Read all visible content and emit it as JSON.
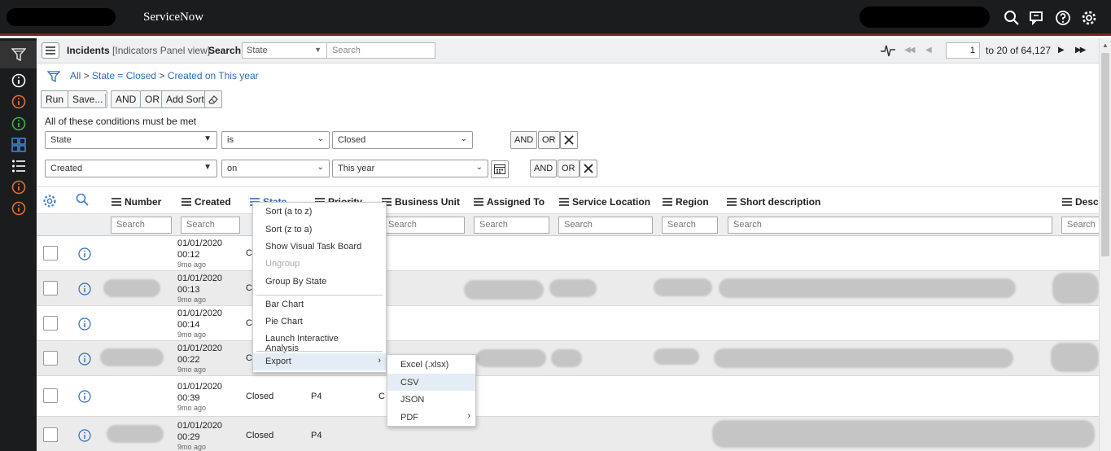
{
  "banner": {
    "brand": "ServiceNow"
  },
  "list_header": {
    "title": "Incidents",
    "view": "[Indicators Panel view]",
    "search_label": "Search",
    "field_select": "State",
    "search_placeholder": "Search",
    "page_value": "1",
    "range_text": "to 20 of 64,127"
  },
  "breadcrumb": {
    "all": "All",
    "sep": ">",
    "state": "State = Closed",
    "created": "Created on This year"
  },
  "filter": {
    "run": "Run",
    "save": "Save...",
    "and": "AND",
    "or": "OR",
    "add_sort": "Add Sort",
    "conditions_title": "All of these conditions must be met",
    "row1": {
      "field": "State",
      "operator": "is",
      "value": "Closed"
    },
    "row2": {
      "field": "Created",
      "operator": "on",
      "value": "This year"
    }
  },
  "columns": {
    "number": "Number",
    "created": "Created",
    "state": "State",
    "priority": "Priority",
    "business_unit": "Business Unit",
    "assigned_to": "Assigned To",
    "service_location": "Service Location",
    "region": "Region",
    "short_description": "Short description",
    "description": "Descri"
  },
  "column_search_placeholder": "Search",
  "rows": [
    {
      "date": "01/01/2020",
      "time": "00:12",
      "ago": "9mo ago",
      "state": "C",
      "priority": "",
      "bu": ""
    },
    {
      "date": "01/01/2020",
      "time": "00:13",
      "ago": "9mo ago",
      "state": "C",
      "priority": "",
      "bu": ""
    },
    {
      "date": "01/01/2020",
      "time": "00:14",
      "ago": "9mo ago",
      "state": "C",
      "priority": "",
      "bu": ""
    },
    {
      "date": "01/01/2020",
      "time": "00:22",
      "ago": "9mo ago",
      "state": "C",
      "priority": "",
      "bu": ""
    },
    {
      "date": "01/01/2020",
      "time": "00:39",
      "ago": "9mo ago",
      "state": "Closed",
      "priority": "P4",
      "bu": "C"
    },
    {
      "date": "01/01/2020",
      "time": "00:29",
      "ago": "9mo ago",
      "state": "Closed",
      "priority": "P4",
      "bu": ""
    }
  ],
  "context_menu": {
    "items": [
      "Sort (a to z)",
      "Sort (z to a)",
      "Show Visual Task Board",
      "Ungroup",
      "Group By State",
      "Bar Chart",
      "Pie Chart",
      "Launch Interactive Analysis",
      "Export"
    ]
  },
  "export_submenu": {
    "items": [
      "Excel (.xlsx)",
      "CSV",
      "JSON",
      "PDF"
    ]
  },
  "colors": {
    "banner_bg": "#1b1c1e",
    "banner_accent": "#7f1d1d",
    "link_blue": "#2e6bb8",
    "nav_orange": "#e3702d",
    "nav_green": "#3cb44b",
    "menu_highlight": "#e4ecf6"
  }
}
